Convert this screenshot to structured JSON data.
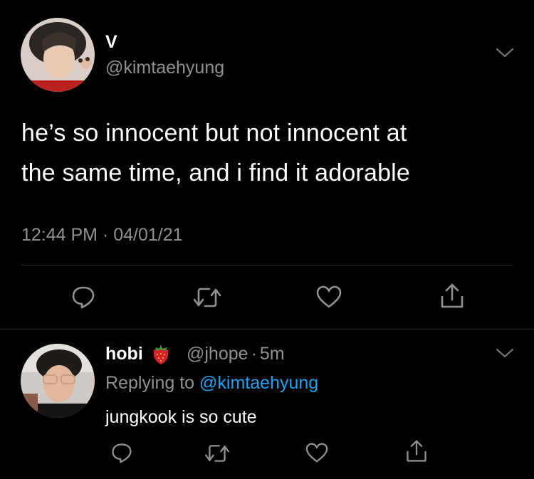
{
  "tweet": {
    "author_name": "V",
    "author_handle": "@kimtaehyung",
    "text_line1": "he’s so innocent but not innocent at",
    "text_line2": "the same time, and i find it adorable",
    "timestamp": "12:44 PM · 04/01/21"
  },
  "reply": {
    "author_name": "hobi",
    "emoji": "strawberry-icon",
    "author_handle": "@jhope",
    "separator": "·",
    "time": "5m",
    "replying_prefix": "Replying to ",
    "replying_handle": "@kimtaehyung",
    "text": "jungkook is so cute"
  },
  "colors": {
    "background": "#000000",
    "text": "#ffffff",
    "muted": "#8e9196",
    "link": "#1da1f2",
    "divider": "#2a2d31"
  },
  "icons": [
    "reply-icon",
    "retweet-icon",
    "like-icon",
    "share-icon",
    "chevron-down-icon"
  ]
}
